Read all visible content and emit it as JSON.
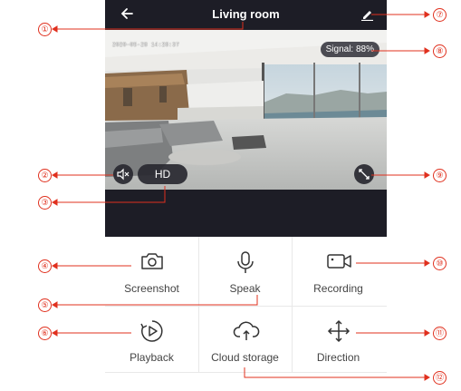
{
  "header": {
    "title": "Living room",
    "back_icon": "arrow-left-icon",
    "edit_icon": "pencil-icon"
  },
  "video": {
    "timestamp": "2020-05-28 14:28:37",
    "signal": "Signal: 88%",
    "hd_label": "HD",
    "mute_icon": "speaker-mute-icon",
    "fullscreen_icon": "fullscreen-icon"
  },
  "actions": [
    {
      "label": "Screenshot",
      "icon": "camera-icon"
    },
    {
      "label": "Speak",
      "icon": "microphone-icon"
    },
    {
      "label": "Recording",
      "icon": "video-camera-icon"
    },
    {
      "label": "Playback",
      "icon": "playback-icon"
    },
    {
      "label": "Cloud storage",
      "icon": "cloud-icon"
    },
    {
      "label": "Direction",
      "icon": "move-arrows-icon"
    }
  ],
  "callouts": [
    "①",
    "②",
    "③",
    "④",
    "⑤",
    "⑥",
    "⑦",
    "⑧",
    "⑨",
    "⑩",
    "⑪",
    "⑫"
  ],
  "colors": {
    "bar": "#1d1d26",
    "callout": "#e0301e"
  }
}
